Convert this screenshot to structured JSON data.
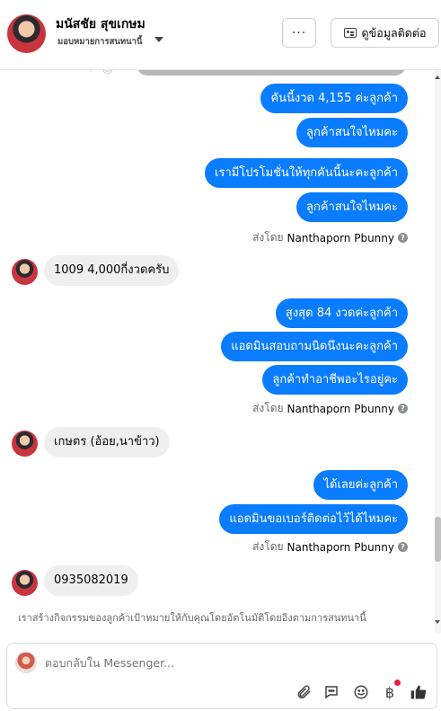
{
  "header": {
    "contact_name": "มนัสชัย สุขเกษม",
    "assign_label": "มอบหมายการสนทนานี้",
    "more_label": "···",
    "view_contact_label": "ดูข้อมูลติดต่อ"
  },
  "conversation": {
    "outgoing_group_1": [
      "คันนี้งวด 4,155 ค่ะลูกค้า",
      "ลูกค้าสนใจไหมคะ"
    ],
    "outgoing_group_2": [
      "เรามีโปรโมชั่นให้ทุกคันนี้นะคะลูกค้า",
      "ลูกค้าสนใจไหมคะ"
    ],
    "sent_by_prefix": "ส่งโดย",
    "sent_by_name": "Nanthaporn Pbunny",
    "incoming_1": "1009  4,000กี่งวดครับ",
    "outgoing_group_3": [
      "สูงสุด 84 งวดค่ะลูกค้า",
      "แอดมินสอบถามนิดนึงนะคะลูกค้า",
      "ลูกค้าทำอาชีพอะไรอยู่คะ"
    ],
    "incoming_2": "เกษตร (อ้อย,นาข้าว)",
    "outgoing_group_4": [
      "ได้เลยค่ะลูกค้า",
      "แอดมินขอเบอร์ติดต่อไว้ได้ไหมคะ"
    ],
    "incoming_3": "0935082019",
    "ai_note": "เราสร้างกิจกรรมของลูกค้าเป้าหมายให้กับคุณโดยอัตโนมัติโดยอิงตามการสนทนานี้"
  },
  "composer": {
    "placeholder": "ตอบกลับใน Messenger..."
  },
  "icons": {
    "attach": "paperclip-icon",
    "saved_replies": "chat-bubble-icon",
    "emoji": "emoji-icon",
    "payment": "baht-icon",
    "like": "thumbs-up-icon"
  },
  "colors": {
    "outgoing_bubble": "#0a7cff",
    "incoming_bubble": "#efefef",
    "badge": "#e41e3f"
  }
}
